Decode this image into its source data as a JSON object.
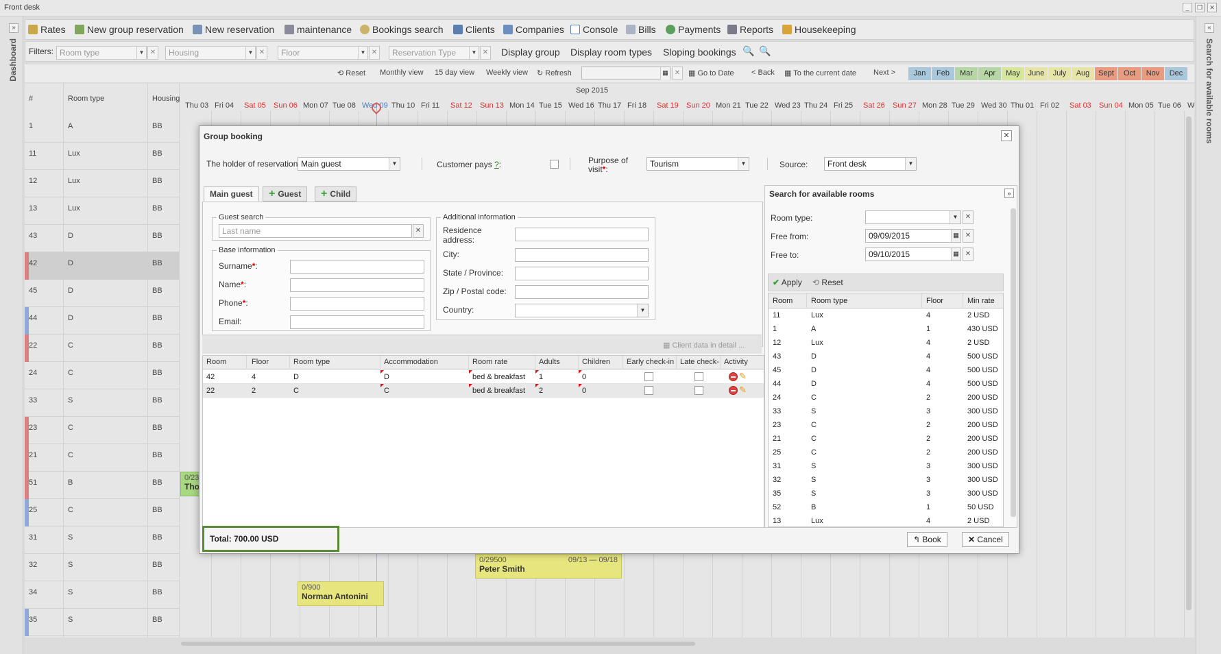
{
  "window": {
    "title": "Front desk"
  },
  "left_rail": {
    "label": "Dashboard"
  },
  "right_rail": {
    "label": "Search for available rooms"
  },
  "toolbar": {
    "items": [
      "Rates",
      "New group reservation",
      "New reservation",
      "maintenance",
      "Bookings search",
      "Clients",
      "Companies",
      "Console",
      "Bills",
      "Payments",
      "Reports",
      "Housekeeping"
    ]
  },
  "filters": {
    "label": "Filters:",
    "room_type": "Room type",
    "housing": "Housing",
    "floor": "Floor",
    "reservation_type": "Reservation Type",
    "links": [
      "Display group",
      "Display room types",
      "Sloping bookings"
    ]
  },
  "nav": {
    "reset": "Reset",
    "monthly": "Monthly view",
    "days15": "15 day view",
    "weekly": "Weekly view",
    "refresh": "Refresh",
    "goto": "Go to Date",
    "back": "< Back",
    "current": "To the current date",
    "next": "Next >",
    "months": [
      "Jan",
      "Feb",
      "Mar",
      "Apr",
      "May",
      "June",
      "July",
      "Aug",
      "Sept",
      "Oct",
      "Nov",
      "Dec"
    ],
    "month_colors": [
      "#a9c8dc",
      "#a9c8dc",
      "#b6d6a6",
      "#b6d6a6",
      "#d6e69a",
      "#e6e4a6",
      "#e6e4a6",
      "#e6e4a6",
      "#e89b7f",
      "#e89b7f",
      "#e89b7f",
      "#a9c8dc"
    ]
  },
  "grid": {
    "col_num": "#",
    "col_room_type": "Room type",
    "col_housing": "Housing",
    "month_label": "Sep 2015",
    "days": [
      "Thu 03",
      "Fri 04",
      "Sat 05",
      "Sun 06",
      "Mon 07",
      "Tue 08",
      "Wed 09",
      "Thu 10",
      "Fri 11",
      "Sat 12",
      "Sun 13",
      "Mon 14",
      "Tue 15",
      "Wed 16",
      "Thu 17",
      "Fri 18",
      "Sat 19",
      "Sun 20",
      "Mon 21",
      "Tue 22",
      "Wed 23",
      "Thu 24",
      "Fri 25",
      "Sat 26",
      "Sun 27",
      "Mon 28",
      "Tue 29",
      "Wed 30",
      "Thu 01",
      "Fri 02",
      "Sat 03",
      "Sun 04",
      "Mon 05",
      "Tue 06",
      "We"
    ],
    "rows": [
      {
        "num": "1",
        "type": "A",
        "housing": "BB",
        "mark": ""
      },
      {
        "num": "11",
        "type": "Lux",
        "housing": "BB",
        "mark": ""
      },
      {
        "num": "12",
        "type": "Lux",
        "housing": "BB",
        "mark": ""
      },
      {
        "num": "13",
        "type": "Lux",
        "housing": "BB",
        "mark": ""
      },
      {
        "num": "43",
        "type": "D",
        "housing": "BB",
        "mark": ""
      },
      {
        "num": "42",
        "type": "D",
        "housing": "BB",
        "mark": "#d98080"
      },
      {
        "num": "45",
        "type": "D",
        "housing": "BB",
        "mark": ""
      },
      {
        "num": "44",
        "type": "D",
        "housing": "BB",
        "mark": "#8fa8d8"
      },
      {
        "num": "22",
        "type": "C",
        "housing": "BB",
        "mark": "#d98080"
      },
      {
        "num": "24",
        "type": "C",
        "housing": "BB",
        "mark": ""
      },
      {
        "num": "33",
        "type": "S",
        "housing": "BB",
        "mark": ""
      },
      {
        "num": "23",
        "type": "C",
        "housing": "BB",
        "mark": "#d98080"
      },
      {
        "num": "21",
        "type": "C",
        "housing": "BB",
        "mark": "#d98080"
      },
      {
        "num": "51",
        "type": "B",
        "housing": "BB",
        "mark": "#d98080"
      },
      {
        "num": "25",
        "type": "C",
        "housing": "BB",
        "mark": "#8fa8d8"
      },
      {
        "num": "31",
        "type": "S",
        "housing": "BB",
        "mark": ""
      },
      {
        "num": "32",
        "type": "S",
        "housing": "BB",
        "mark": ""
      },
      {
        "num": "34",
        "type": "S",
        "housing": "BB",
        "mark": ""
      },
      {
        "num": "35",
        "type": "S",
        "housing": "BB",
        "mark": "#8fa8d8"
      }
    ],
    "bookings": [
      {
        "amount": "0/23",
        "name": "Tho"
      },
      {
        "amount": "0/29500",
        "dates": "09/13 — 09/18",
        "name": "Peter Smith"
      },
      {
        "amount": "0/900",
        "name": "Norman Antonini"
      }
    ]
  },
  "dialog": {
    "title": "Group booking",
    "holder_label": "The holder of reservation",
    "holder_value": "Main guest",
    "customer_pays_label": "Customer pays",
    "customer_pays_help": "?",
    "purpose_label_1": "Purpose of",
    "purpose_label_2": "visit",
    "purpose_value": "Tourism",
    "source_label": "Source:",
    "source_value": "Front desk",
    "tabs": [
      "Main guest",
      "Guest",
      "Child"
    ],
    "guest_search": {
      "legend": "Guest search",
      "placeholder": "Last name"
    },
    "base_info": {
      "legend": "Base information",
      "surname": "Surname",
      "name": "Name",
      "phone": "Phone",
      "email": "Email:"
    },
    "additional_info": {
      "legend": "Additional information",
      "residence_1": "Residence",
      "residence_2": "address:",
      "city": "City:",
      "state": "State / Province:",
      "zip": "Zip / Postal code:",
      "country": "Country:"
    },
    "client_detail": "Client data in detail ...",
    "table": {
      "headers": [
        "Room",
        "Floor",
        "Room type",
        "Accommodation",
        "Room rate",
        "Adults",
        "Children",
        "Early check-in",
        "Late check-",
        "Activity"
      ],
      "rows": [
        {
          "room": "42",
          "floor": "4",
          "type": "D",
          "accommodation": "D",
          "rate": "bed & breakfast",
          "adults": "1",
          "children": "0"
        },
        {
          "room": "22",
          "floor": "2",
          "type": "C",
          "accommodation": "C",
          "rate": "bed & breakfast",
          "adults": "2",
          "children": "0"
        }
      ]
    },
    "total": "Total:  700.00 USD",
    "book": "Book",
    "cancel": "Cancel"
  },
  "search_panel": {
    "title": "Search for available rooms",
    "room_type_label": "Room type:",
    "free_from_label": "Free from:",
    "free_from": "09/09/2015",
    "free_to_label": "Free to:",
    "free_to": "09/10/2015",
    "apply": "Apply",
    "reset": "Reset",
    "headers": [
      "Room",
      "Room type",
      "Floor",
      "Min rate"
    ],
    "rows": [
      [
        "11",
        "Lux",
        "4",
        "2 USD"
      ],
      [
        "1",
        "A",
        "1",
        "430 USD"
      ],
      [
        "12",
        "Lux",
        "4",
        "2 USD"
      ],
      [
        "43",
        "D",
        "4",
        "500 USD"
      ],
      [
        "45",
        "D",
        "4",
        "500 USD"
      ],
      [
        "44",
        "D",
        "4",
        "500 USD"
      ],
      [
        "24",
        "C",
        "2",
        "200 USD"
      ],
      [
        "33",
        "S",
        "3",
        "300 USD"
      ],
      [
        "23",
        "C",
        "2",
        "200 USD"
      ],
      [
        "21",
        "C",
        "2",
        "200 USD"
      ],
      [
        "25",
        "C",
        "2",
        "200 USD"
      ],
      [
        "31",
        "S",
        "3",
        "300 USD"
      ],
      [
        "32",
        "S",
        "3",
        "300 USD"
      ],
      [
        "35",
        "S",
        "3",
        "300 USD"
      ],
      [
        "52",
        "B",
        "1",
        "50 USD"
      ],
      [
        "13",
        "Lux",
        "4",
        "2 USD"
      ]
    ]
  }
}
